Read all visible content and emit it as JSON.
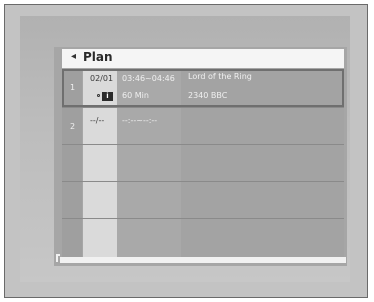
{
  "header": {
    "back_arrow": "◂",
    "title": "Plan"
  },
  "rows": [
    {
      "number": "1",
      "date": "02/01",
      "time": "03:46~04:46",
      "duration": "60 Min",
      "title": "Lord of the Ring",
      "channel": "2340 BBC",
      "info_icon": "i"
    },
    {
      "number": "2",
      "date": "--/--",
      "time": "--:--~--:--"
    }
  ]
}
